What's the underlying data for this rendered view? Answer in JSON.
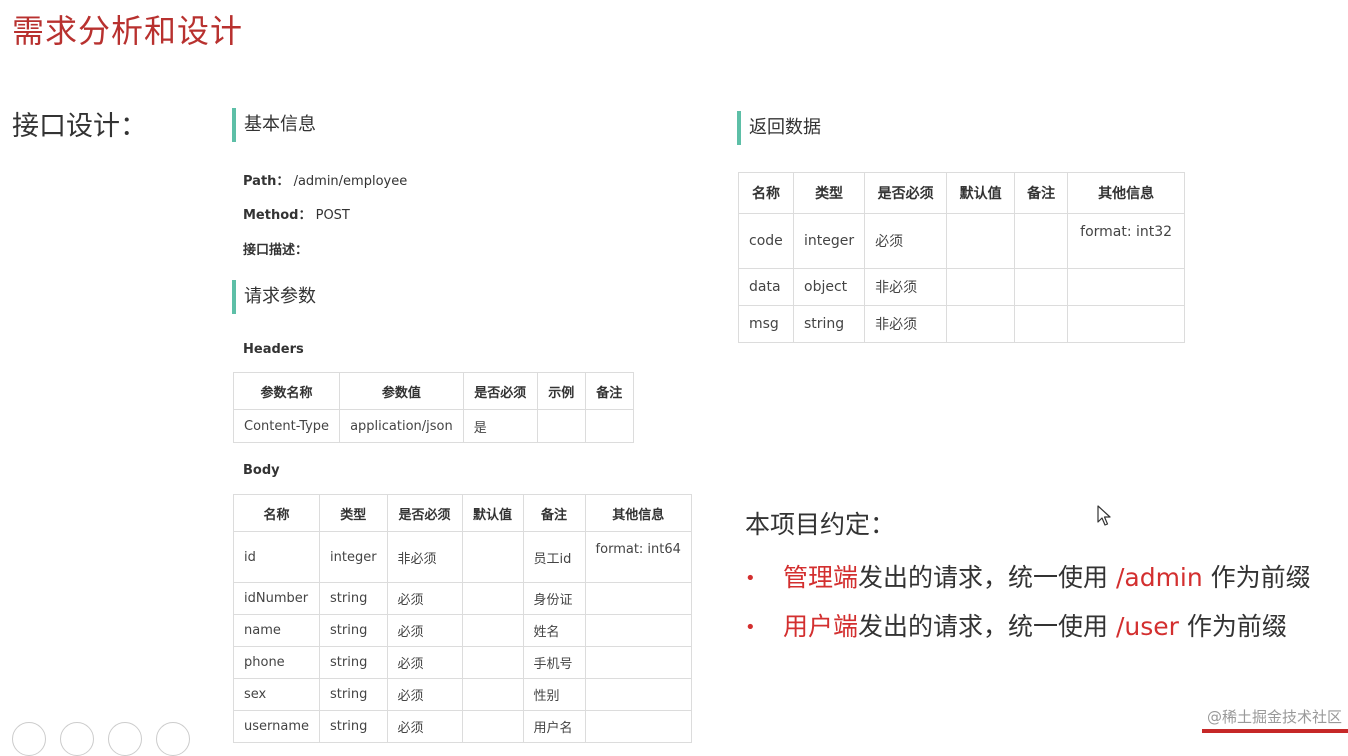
{
  "title": "需求分析和设计",
  "section_label": "接口设计：",
  "basic_info": {
    "heading": "基本信息",
    "path_label": "Path：",
    "path_value": "/admin/employee",
    "method_label": "Method：",
    "method_value": "POST",
    "desc_label": "接口描述："
  },
  "request_params": {
    "heading": "请求参数",
    "headers_label": "Headers",
    "headers_table": {
      "columns": [
        "参数名称",
        "参数值",
        "是否必须",
        "示例",
        "备注"
      ],
      "rows": [
        [
          "Content-Type",
          "application/json",
          "是",
          "",
          ""
        ]
      ]
    },
    "body_label": "Body",
    "body_table": {
      "columns": [
        "名称",
        "类型",
        "是否必须",
        "默认值",
        "备注",
        "其他信息"
      ],
      "rows": [
        [
          "id",
          "integer",
          "非必须",
          "",
          "员工id",
          "format: int64"
        ],
        [
          "idNumber",
          "string",
          "必须",
          "",
          "身份证",
          ""
        ],
        [
          "name",
          "string",
          "必须",
          "",
          "姓名",
          ""
        ],
        [
          "phone",
          "string",
          "必须",
          "",
          "手机号",
          ""
        ],
        [
          "sex",
          "string",
          "必须",
          "",
          "性别",
          ""
        ],
        [
          "username",
          "string",
          "必须",
          "",
          "用户名",
          ""
        ]
      ]
    }
  },
  "return_data": {
    "heading": "返回数据",
    "table": {
      "columns": [
        "名称",
        "类型",
        "是否必须",
        "默认值",
        "备注",
        "其他信息"
      ],
      "rows": [
        [
          "code",
          "integer",
          "必须",
          "",
          "",
          "format: int32"
        ],
        [
          "data",
          "object",
          "非必须",
          "",
          "",
          ""
        ],
        [
          "msg",
          "string",
          "非必须",
          "",
          "",
          ""
        ]
      ]
    }
  },
  "convention": {
    "title": "本项目约定：",
    "items": [
      {
        "highlight": "管理端",
        "text1": "发出的请求，统一使用 ",
        "path": "/admin",
        "text2": " 作为前缀"
      },
      {
        "highlight": "用户端",
        "text1": "发出的请求，统一使用 ",
        "path": "/user",
        "text2": " 作为前缀"
      }
    ]
  },
  "watermark": "@稀土掘金技术社区",
  "colors": {
    "title": "#b8312f",
    "accent_bar": "#5dbfa7",
    "highlight": "#d32f2f"
  }
}
